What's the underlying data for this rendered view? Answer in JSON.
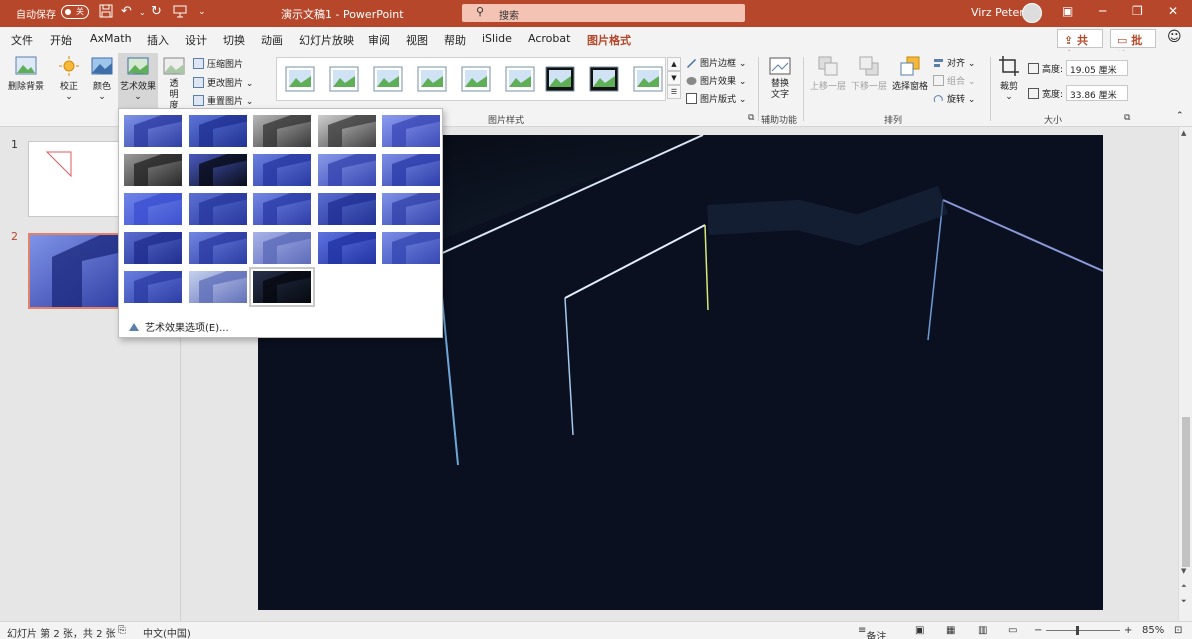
{
  "titlebar": {
    "autosave_label": "自动保存",
    "autosave_state": "关",
    "doc_title": "演示文稿1  -  PowerPoint",
    "search_placeholder": "搜索",
    "user_name": "Virz Peter",
    "accent": "#b7472a"
  },
  "tabs": [
    {
      "label": "文件"
    },
    {
      "label": "开始"
    },
    {
      "label": "AxMath"
    },
    {
      "label": "插入"
    },
    {
      "label": "设计"
    },
    {
      "label": "切换"
    },
    {
      "label": "动画"
    },
    {
      "label": "幻灯片放映"
    },
    {
      "label": "审阅"
    },
    {
      "label": "视图"
    },
    {
      "label": "帮助"
    },
    {
      "label": "iSlide"
    },
    {
      "label": "Acrobat"
    },
    {
      "label": "图片格式",
      "active": true
    }
  ],
  "share": {
    "label": "共享"
  },
  "comments": {
    "label": "批注"
  },
  "ribbon": {
    "remove_bg": "删除背景",
    "corrections": "校正",
    "color": "颜色",
    "artistic_effects": "艺术效果",
    "transparency": "透明度",
    "compress": "压缩图片",
    "change_picture": "更改图片",
    "reset_picture": "重置图片",
    "picture_styles_label": "图片样式",
    "picture_border": "图片边框",
    "picture_effects": "图片效果",
    "picture_layout": "图片版式",
    "alt_text": "替换文字",
    "accessibility_label": "辅助功能",
    "bring_forward": "上移一层",
    "send_backward": "下移一层",
    "selection_pane": "选择窗格",
    "align": "对齐",
    "group": "组合",
    "rotate": "旋转",
    "arrange_label": "排列",
    "crop": "裁剪",
    "height_label": "高度:",
    "height_value": "19.05 厘米",
    "width_label": "宽度:",
    "width_value": "33.86 厘米",
    "size_label": "大小"
  },
  "thumbnails": [
    {
      "number": "1"
    },
    {
      "number": "2",
      "selected": true
    }
  ],
  "gallery": {
    "options_label": "艺术效果选项(E)...",
    "selected_index": 22
  },
  "statusbar": {
    "slide_info": "幻灯片 第 2 张，共 2 张",
    "language": "中文(中国)",
    "notes": "备注",
    "zoom": "85%"
  }
}
